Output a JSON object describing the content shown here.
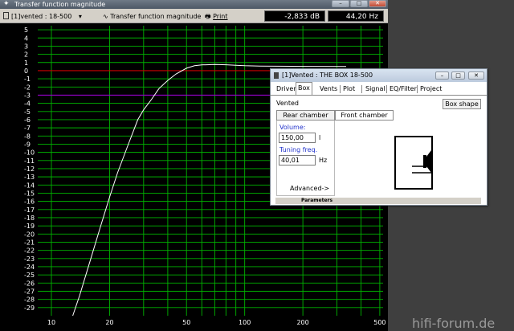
{
  "main_window": {
    "title": "Transfer function magnitude",
    "controls": [
      "–",
      "□",
      "✕"
    ]
  },
  "toolbar": {
    "curve_selector": "[1]vented : 18-500",
    "mode_selector": "Transfer function magnitude",
    "print_label": "Print",
    "readout_db": "-2,833 dB",
    "readout_hz": "44,20 Hz"
  },
  "chart_data": {
    "type": "line",
    "x_scale": "log",
    "xlim": [
      8.5,
      520
    ],
    "ylim": [
      -30,
      5.5
    ],
    "x_ticks": [
      10,
      20,
      50,
      100,
      200,
      500
    ],
    "x_grid": [
      10,
      20,
      30,
      40,
      50,
      60,
      70,
      80,
      90,
      100,
      200,
      300,
      400,
      500
    ],
    "y_ticks": [
      5,
      4,
      3,
      2,
      1,
      0,
      -1,
      -2,
      -3,
      -4,
      -5,
      -6,
      -7,
      -8,
      -9,
      -10,
      -11,
      -12,
      -13,
      -14,
      -15,
      -16,
      -17,
      -18,
      -19,
      -20,
      -21,
      -22,
      -23,
      -24,
      -25,
      -26,
      -27,
      -28,
      -29
    ],
    "reference_lines": [
      {
        "y": 0,
        "color": "#cc0000"
      },
      {
        "y": -3,
        "color": "#9900cc"
      }
    ],
    "series": [
      {
        "color": "#ffffff",
        "x": [
          12.9,
          14,
          16,
          18,
          20,
          22,
          25,
          28,
          30,
          33,
          36,
          40,
          44.2,
          50,
          55,
          60,
          70,
          80,
          90,
          100,
          120
        ],
        "y": [
          -30,
          -27.5,
          -23,
          -19,
          -15.5,
          -12.5,
          -9,
          -6,
          -4.8,
          -3.5,
          -2.2,
          -1.2,
          -0.4,
          0.3,
          0.6,
          0.7,
          0.75,
          0.72,
          0.66,
          0.6,
          0.55
        ]
      }
    ],
    "curve_end_x": 335,
    "curve_end_y": 0.5
  },
  "dialog": {
    "title": "[1]Vented : THE BOX 18-500",
    "controls": [
      "–",
      "□",
      "✕"
    ],
    "tabs": [
      "Driver",
      "Box",
      "Vents",
      "Plot",
      "Signal",
      "EQ/Filter",
      "Project"
    ],
    "active_tab": "Box",
    "box_type": "Vented",
    "box_shape_button": "Box shape",
    "rear_chamber_button": "Rear chamber",
    "front_chamber_button": "Front chamber",
    "volume_label": "Volume:",
    "volume_value": "150,00",
    "volume_unit": "l",
    "tuning_label": "Tuning freq.",
    "tuning_value": "40,01",
    "tuning_unit": "Hz",
    "advanced_button": "Advanced->",
    "parameters_label": "Parameters"
  },
  "watermark": {
    "text": "hifi-forum.de"
  }
}
